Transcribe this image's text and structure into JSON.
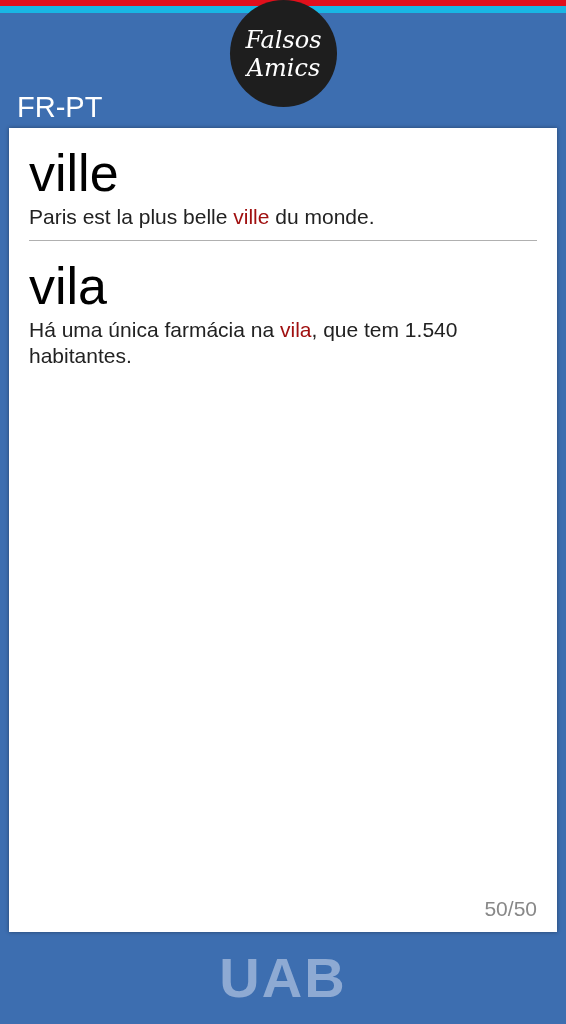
{
  "logo": {
    "line_1": "Falsos",
    "line_2": "Amics"
  },
  "language_pair": "FR-PT",
  "entries": [
    {
      "word": "ville",
      "example": [
        {
          "text": "Paris est la plus belle ",
          "highlight": false
        },
        {
          "text": "ville",
          "highlight": true
        },
        {
          "text": " du monde.",
          "highlight": false
        }
      ]
    },
    {
      "word": "vila",
      "example": [
        {
          "text": "Há uma única farmácia na ",
          "highlight": false
        },
        {
          "text": "vila",
          "highlight": true
        },
        {
          "text": ", que tem 1.540 habitantes.",
          "highlight": false
        }
      ]
    }
  ],
  "counter": "50/50",
  "footer_logo": "UAB"
}
